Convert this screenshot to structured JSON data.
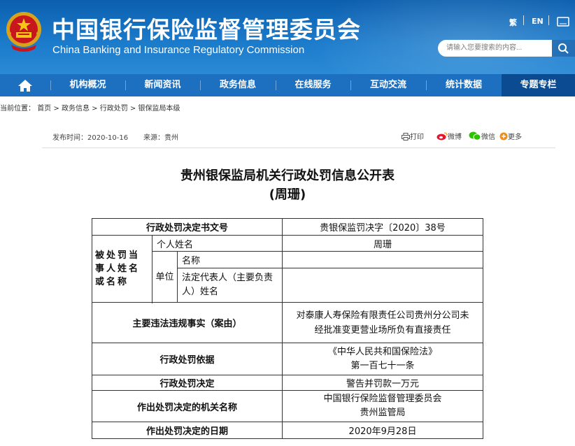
{
  "header": {
    "title_cn": "中国银行保险监督管理委员会",
    "title_en": "China Banking and Insurance Regulatory Commission",
    "lang_traditional": "繁",
    "lang_en": "EN",
    "search_placeholder": "请输入您要搜索的内容..."
  },
  "nav": {
    "items": [
      "机构概况",
      "新闻资讯",
      "政务信息",
      "在线服务",
      "互动交流",
      "统计数据",
      "专题专栏"
    ]
  },
  "breadcrumb": {
    "label": "当前位置：",
    "items": [
      "首页",
      "政务信息",
      "行政处罚",
      "银保监局本级"
    ],
    "sep": ">"
  },
  "meta": {
    "date_label": "发布时间：",
    "date": "2020-10-16",
    "source_label": "来源：",
    "source": "贵州"
  },
  "share": {
    "print": "打印",
    "weibo": "微博",
    "wechat": "微信",
    "more": "更多"
  },
  "document": {
    "title_line1": "贵州银保监局机关行政处罚信息公开表",
    "title_line2": "(周珊)"
  },
  "table": {
    "doc_no_label": "行政处罚决定书文号",
    "doc_no": "贵银保监罚决字〔2020〕38号",
    "party_label": "被处罚当事人姓名或名称",
    "individual_label": "个人姓名",
    "individual_value": "周珊",
    "unit_label": "单位",
    "unit_name_label": "名称",
    "unit_name_value": "",
    "legal_rep_label": "法定代表人（主要负责人）姓名",
    "legal_rep_value": "",
    "facts_label": "主要违法违规事实（案由）",
    "facts_value": "对泰康人寿保险有限责任公司贵州分公司未经批准变更营业场所负有直接责任",
    "basis_label": "行政处罚依据",
    "basis_value_line1": "《中华人民共和国保险法》",
    "basis_value_line2": "第一百七十一条",
    "decision_label": "行政处罚决定",
    "decision_value": "警告并罚款一万元",
    "authority_label": "作出处罚决定的机关名称",
    "authority_value_line1": "中国银行保险监督管理委员会",
    "authority_value_line2": "贵州监管局",
    "date_label": "作出处罚决定的日期",
    "date_value": "2020年9月28日"
  }
}
